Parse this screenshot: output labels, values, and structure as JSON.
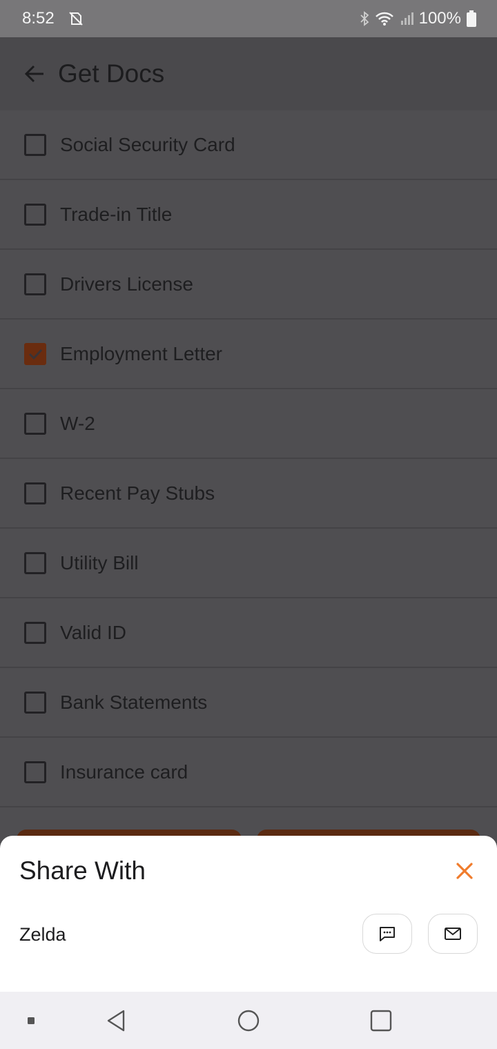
{
  "status_bar": {
    "time": "8:52",
    "battery": "100%",
    "icons": [
      "notification-off-icon",
      "bluetooth-icon",
      "wifi-icon",
      "signal-icon",
      "battery-icon"
    ]
  },
  "app_bar": {
    "title": "Get Docs",
    "back_icon": "arrow-left-icon"
  },
  "documents": [
    {
      "label": "Social Security Card",
      "checked": false
    },
    {
      "label": "Trade-in Title",
      "checked": false
    },
    {
      "label": "Drivers License",
      "checked": false
    },
    {
      "label": "Employment Letter",
      "checked": true
    },
    {
      "label": "W-2",
      "checked": false
    },
    {
      "label": "Recent Pay Stubs",
      "checked": false
    },
    {
      "label": "Utility Bill",
      "checked": false
    },
    {
      "label": "Valid ID",
      "checked": false
    },
    {
      "label": "Bank Statements",
      "checked": false
    },
    {
      "label": "Insurance card",
      "checked": false
    }
  ],
  "share_sheet": {
    "title": "Share With",
    "contact": "Zelda",
    "close_icon": "close-icon",
    "actions": [
      "message-icon",
      "mail-icon"
    ]
  },
  "nav_bar": {
    "icons": [
      "recent-apps-dot-icon",
      "back-triangle-icon",
      "home-circle-icon",
      "overview-square-icon"
    ]
  },
  "colors": {
    "accent": "#f07c2c",
    "checked_box": "#6a2c0f",
    "scrim_background": "#4f4e51"
  }
}
